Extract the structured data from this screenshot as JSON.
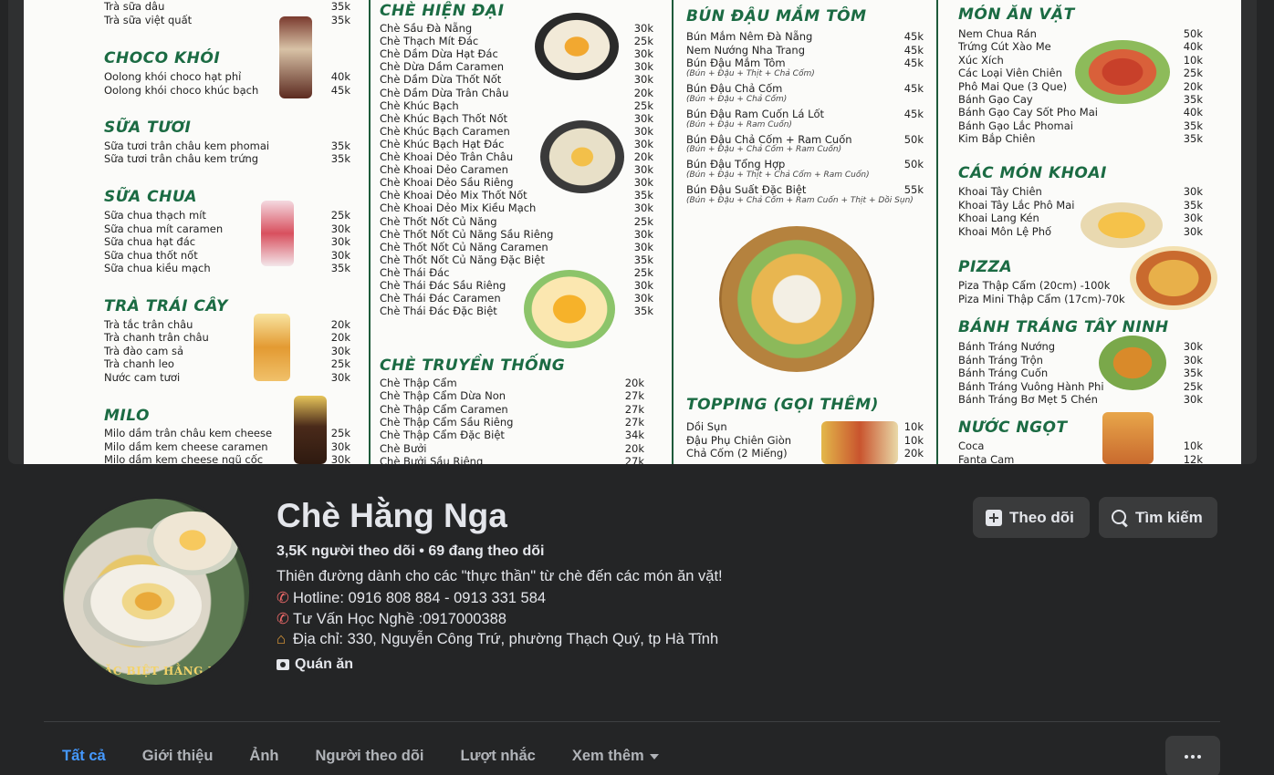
{
  "cover": {
    "columns": [
      {
        "sections": [
          {
            "title": "",
            "items": [
              [
                "Trà sữa dâu",
                "35k"
              ],
              [
                "Trà sữa việt quất",
                "35k"
              ]
            ]
          },
          {
            "title": "CHOCO KHÓI",
            "items": [
              [
                "Oolong khói choco hạt phỉ",
                "40k"
              ],
              [
                "Oolong khói choco khúc bạch",
                "45k"
              ]
            ]
          },
          {
            "title": "SỮA TƯƠI",
            "items": [
              [
                "Sữa tươi trân châu kem phomai",
                "35k"
              ],
              [
                "Sữa tươi trân châu kem trứng",
                "35k"
              ]
            ]
          },
          {
            "title": "SỮA CHUA",
            "items": [
              [
                "Sữa chua thạch mít",
                "25k"
              ],
              [
                "Sữa chua mít caramen",
                "30k"
              ],
              [
                "Sữa chua hạt đác",
                "30k"
              ],
              [
                "Sữa chua thốt nốt",
                "30k"
              ],
              [
                "Sữa chua kiều mạch",
                "35k"
              ]
            ]
          },
          {
            "title": "TRÀ TRÁI CÂY",
            "items": [
              [
                "Trà tắc trân châu",
                "20k"
              ],
              [
                "Trà chanh trân châu",
                "20k"
              ],
              [
                "Trà đào cam sả",
                "30k"
              ],
              [
                "Trà chanh leo",
                "25k"
              ],
              [
                "Nước cam tươi",
                "30k"
              ]
            ]
          },
          {
            "title": "MILO",
            "items": [
              [
                "Milo dầm trân châu kem cheese",
                "25k"
              ],
              [
                "Milo dầm kem cheese caramen",
                "30k"
              ],
              [
                "Milo dầm kem cheese ngũ cốc",
                "30k"
              ]
            ]
          }
        ]
      },
      {
        "sections": [
          {
            "title": "CHÈ HIỆN ĐẠI",
            "items": [
              [
                "Chè Sầu Đà Nẵng",
                "30k"
              ],
              [
                "Chè Thạch Mít Đác",
                "25k"
              ],
              [
                "Chè Dầm Dừa Hạt Đác",
                "30k"
              ],
              [
                "Chè Dừa Dầm Caramen",
                "30k"
              ],
              [
                "Chè Dầm Dừa Thốt Nốt",
                "30k"
              ],
              [
                "Chè Dầm Dừa Trân Châu",
                "20k"
              ],
              [
                "Chè Khúc Bạch",
                "25k"
              ],
              [
                "Chè Khúc Bạch Thốt Nốt",
                "30k"
              ],
              [
                "Chè Khúc Bạch Caramen",
                "30k"
              ],
              [
                "Chè Khúc Bạch Hạt Đác",
                "30k"
              ],
              [
                "Chè Khoai Dẻo Trân Châu",
                "20k"
              ],
              [
                "Chè Khoai Dẻo Caramen",
                "30k"
              ],
              [
                "Chè Khoai Dẻo Sầu Riêng",
                "30k"
              ],
              [
                "Chè Khoai Dẻo Mix Thốt Nốt",
                "35k"
              ],
              [
                "Chè Khoai Dẻo Mix Kiều Mạch",
                "30k"
              ],
              [
                "Chè Thốt Nốt Củ Năng",
                "25k"
              ],
              [
                "Chè Thốt Nốt Củ Năng Sầu Riêng",
                "30k"
              ],
              [
                "Chè Thốt Nốt Củ Năng Caramen",
                "30k"
              ],
              [
                "Chè Thốt Nốt Củ Năng Đặc Biệt",
                "35k"
              ],
              [
                "Chè Thái Đác",
                "25k"
              ],
              [
                "Chè Thái Đác Sầu Riêng",
                "30k"
              ],
              [
                "Chè Thái Đác Caramen",
                "30k"
              ],
              [
                "Chè Thái Đác Đặc Biệt",
                "35k"
              ]
            ]
          },
          {
            "title": "CHÈ TRUYỀN THỐNG",
            "items": [
              [
                "Chè Thập Cẩm",
                "20k"
              ],
              [
                "Chè Thập Cẩm Dừa Non",
                "27k"
              ],
              [
                "Chè Thập Cẩm Caramen",
                "27k"
              ],
              [
                "Chè Thập Cẩm Sầu Riêng",
                "27k"
              ],
              [
                "Chè Thập Cẩm Đặc Biệt",
                "34k"
              ],
              [
                "Chè Bưởi",
                "20k"
              ],
              [
                "Chè Bưởi Sầu Riêng",
                "27k"
              ]
            ]
          }
        ]
      },
      {
        "sections": [
          {
            "title": "BÚN ĐẬU MẮM TÔM",
            "items": [
              [
                "Bún Mắm Nêm Đà Nẵng",
                "45k",
                ""
              ],
              [
                "Nem Nướng Nha Trang",
                "45k",
                ""
              ],
              [
                "Bún Đậu Mắm Tôm",
                "45k",
                "(Bún + Đậu + Thịt + Chả Cốm)"
              ],
              [
                "Bún Đậu Chả Cốm",
                "45k",
                "(Bún + Đậu + Chả Cốm)"
              ],
              [
                "Bún Đậu Ram Cuốn Lá Lốt",
                "45k",
                "(Bún + Đậu + Ram Cuốn)"
              ],
              [
                "Bún Đậu Chả Cốm + Ram Cuốn",
                "50k",
                "(Bún + Đậu + Chả Cốm + Ram Cuốn)"
              ],
              [
                "Bún Đậu Tổng Hợp",
                "50k",
                "(Bún + Đậu + Thịt + Chả Cốm + Ram Cuốn)"
              ],
              [
                "Bún Đậu Suất Đặc Biệt",
                "55k",
                "(Bún + Đậu + Chả Cốm + Ram Cuốn + Thịt + Dồi Sụn)"
              ]
            ]
          },
          {
            "title": "TOPPING (GỌI THÊM)",
            "items": [
              [
                "Dồi Sụn",
                "10k",
                ""
              ],
              [
                "Đậu Phụ Chiên Giòn",
                "10k",
                ""
              ],
              [
                "Chả Cốm (2 Miếng)",
                "20k",
                ""
              ]
            ]
          }
        ]
      },
      {
        "sections": [
          {
            "title": "MÓN ĂN VẶT",
            "items": [
              [
                "Nem Chua Rán",
                "50k"
              ],
              [
                "Trứng Cút Xào Me",
                "40k"
              ],
              [
                "Xúc Xích",
                "10k"
              ],
              [
                "Các Loại Viên Chiên",
                "25k"
              ],
              [
                "Phô Mai Que (3 Que)",
                "20k"
              ],
              [
                "Bánh Gạo Cay",
                "35k"
              ],
              [
                "Bánh Gạo Cay Sốt Pho Mai",
                "40k"
              ],
              [
                "Bánh Gạo Lắc Phomai",
                "35k"
              ],
              [
                "Kim Bắp Chiên",
                "35k"
              ]
            ]
          },
          {
            "title": "CÁC MÓN KHOAI",
            "items": [
              [
                "Khoai Tây Chiên",
                "30k"
              ],
              [
                "Khoai Tây Lắc Phô Mai",
                "35k"
              ],
              [
                "Khoai Lang Kén",
                "30k"
              ],
              [
                "Khoai Môn Lệ Phố",
                "30k"
              ]
            ]
          },
          {
            "title": "PIZZA",
            "items": [
              [
                "Piza Thập Cẩm (20cm) -100k",
                ""
              ],
              [
                "Piza Mini Thập Cẩm (17cm)-70k",
                ""
              ]
            ]
          },
          {
            "title": "BÁNH TRÁNG TÂY NINH",
            "items": [
              [
                "Bánh Tráng Nướng",
                "30k"
              ],
              [
                "Bánh Tráng Trộn",
                "30k"
              ],
              [
                "Bánh Tráng Cuốn",
                "35k"
              ],
              [
                "Bánh Tráng Vuông Hành Phi",
                "25k"
              ],
              [
                "Bánh Tráng Bơ Mẹt 5 Chén",
                "30k"
              ]
            ]
          },
          {
            "title": "NƯỚC NGỌT",
            "items": [
              [
                "Coca",
                "10k"
              ],
              [
                "Fanta Cam",
                "12k"
              ]
            ]
          }
        ]
      }
    ]
  },
  "profile": {
    "avatar_caption": "ĐẶC BIỆT HẰNG NGA",
    "name": "Chè Hằng Nga",
    "followers": "3,5K người theo dõi • 69 đang theo dõi",
    "bio": "Thiên đường dành cho các \"thực thần\" từ chè đến các món ăn vặt!",
    "hotline": "Hotline: 0916 808 884 - 0913 331 584",
    "advice": "Tư Vấn Học Nghề :0917000388",
    "address": "Địa chỉ: 330, Nguyễn Công Trứ, phường Thạch Quý, tp Hà Tĩnh",
    "category": "Quán ăn"
  },
  "actions": {
    "follow_label": "Theo dõi",
    "search_label": "Tìm kiếm"
  },
  "tabs": [
    {
      "label": "Tất cả",
      "active": true
    },
    {
      "label": "Giới thiệu"
    },
    {
      "label": "Ảnh"
    },
    {
      "label": "Người theo dõi"
    },
    {
      "label": "Lượt nhắc"
    },
    {
      "label": "Xem thêm"
    }
  ],
  "colors": {
    "background": "#242526",
    "button": "#3a3b3c",
    "active_tab": "#4599ff",
    "menu_green": "#1b6b43"
  }
}
